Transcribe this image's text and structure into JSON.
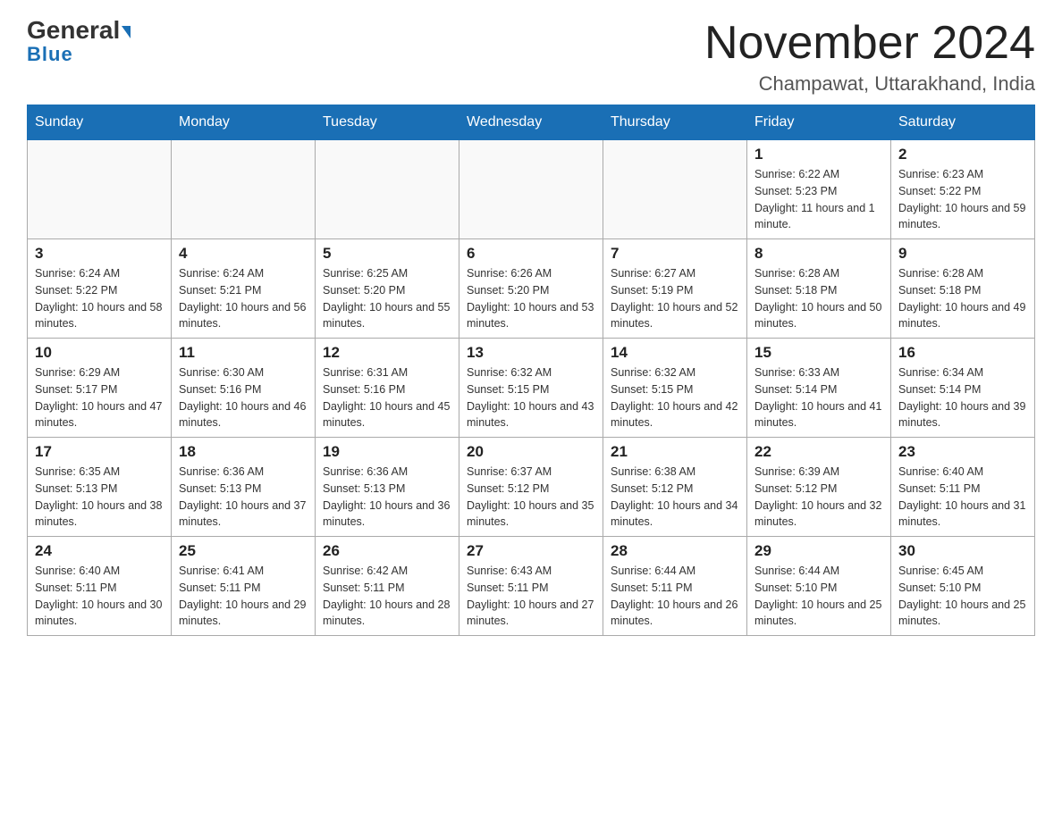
{
  "header": {
    "logo_general": "General",
    "logo_blue": "Blue",
    "month_title": "November 2024",
    "location": "Champawat, Uttarakhand, India"
  },
  "weekdays": [
    "Sunday",
    "Monday",
    "Tuesday",
    "Wednesday",
    "Thursday",
    "Friday",
    "Saturday"
  ],
  "weeks": [
    [
      {
        "day": "",
        "info": ""
      },
      {
        "day": "",
        "info": ""
      },
      {
        "day": "",
        "info": ""
      },
      {
        "day": "",
        "info": ""
      },
      {
        "day": "",
        "info": ""
      },
      {
        "day": "1",
        "info": "Sunrise: 6:22 AM\nSunset: 5:23 PM\nDaylight: 11 hours and 1 minute."
      },
      {
        "day": "2",
        "info": "Sunrise: 6:23 AM\nSunset: 5:22 PM\nDaylight: 10 hours and 59 minutes."
      }
    ],
    [
      {
        "day": "3",
        "info": "Sunrise: 6:24 AM\nSunset: 5:22 PM\nDaylight: 10 hours and 58 minutes."
      },
      {
        "day": "4",
        "info": "Sunrise: 6:24 AM\nSunset: 5:21 PM\nDaylight: 10 hours and 56 minutes."
      },
      {
        "day": "5",
        "info": "Sunrise: 6:25 AM\nSunset: 5:20 PM\nDaylight: 10 hours and 55 minutes."
      },
      {
        "day": "6",
        "info": "Sunrise: 6:26 AM\nSunset: 5:20 PM\nDaylight: 10 hours and 53 minutes."
      },
      {
        "day": "7",
        "info": "Sunrise: 6:27 AM\nSunset: 5:19 PM\nDaylight: 10 hours and 52 minutes."
      },
      {
        "day": "8",
        "info": "Sunrise: 6:28 AM\nSunset: 5:18 PM\nDaylight: 10 hours and 50 minutes."
      },
      {
        "day": "9",
        "info": "Sunrise: 6:28 AM\nSunset: 5:18 PM\nDaylight: 10 hours and 49 minutes."
      }
    ],
    [
      {
        "day": "10",
        "info": "Sunrise: 6:29 AM\nSunset: 5:17 PM\nDaylight: 10 hours and 47 minutes."
      },
      {
        "day": "11",
        "info": "Sunrise: 6:30 AM\nSunset: 5:16 PM\nDaylight: 10 hours and 46 minutes."
      },
      {
        "day": "12",
        "info": "Sunrise: 6:31 AM\nSunset: 5:16 PM\nDaylight: 10 hours and 45 minutes."
      },
      {
        "day": "13",
        "info": "Sunrise: 6:32 AM\nSunset: 5:15 PM\nDaylight: 10 hours and 43 minutes."
      },
      {
        "day": "14",
        "info": "Sunrise: 6:32 AM\nSunset: 5:15 PM\nDaylight: 10 hours and 42 minutes."
      },
      {
        "day": "15",
        "info": "Sunrise: 6:33 AM\nSunset: 5:14 PM\nDaylight: 10 hours and 41 minutes."
      },
      {
        "day": "16",
        "info": "Sunrise: 6:34 AM\nSunset: 5:14 PM\nDaylight: 10 hours and 39 minutes."
      }
    ],
    [
      {
        "day": "17",
        "info": "Sunrise: 6:35 AM\nSunset: 5:13 PM\nDaylight: 10 hours and 38 minutes."
      },
      {
        "day": "18",
        "info": "Sunrise: 6:36 AM\nSunset: 5:13 PM\nDaylight: 10 hours and 37 minutes."
      },
      {
        "day": "19",
        "info": "Sunrise: 6:36 AM\nSunset: 5:13 PM\nDaylight: 10 hours and 36 minutes."
      },
      {
        "day": "20",
        "info": "Sunrise: 6:37 AM\nSunset: 5:12 PM\nDaylight: 10 hours and 35 minutes."
      },
      {
        "day": "21",
        "info": "Sunrise: 6:38 AM\nSunset: 5:12 PM\nDaylight: 10 hours and 34 minutes."
      },
      {
        "day": "22",
        "info": "Sunrise: 6:39 AM\nSunset: 5:12 PM\nDaylight: 10 hours and 32 minutes."
      },
      {
        "day": "23",
        "info": "Sunrise: 6:40 AM\nSunset: 5:11 PM\nDaylight: 10 hours and 31 minutes."
      }
    ],
    [
      {
        "day": "24",
        "info": "Sunrise: 6:40 AM\nSunset: 5:11 PM\nDaylight: 10 hours and 30 minutes."
      },
      {
        "day": "25",
        "info": "Sunrise: 6:41 AM\nSunset: 5:11 PM\nDaylight: 10 hours and 29 minutes."
      },
      {
        "day": "26",
        "info": "Sunrise: 6:42 AM\nSunset: 5:11 PM\nDaylight: 10 hours and 28 minutes."
      },
      {
        "day": "27",
        "info": "Sunrise: 6:43 AM\nSunset: 5:11 PM\nDaylight: 10 hours and 27 minutes."
      },
      {
        "day": "28",
        "info": "Sunrise: 6:44 AM\nSunset: 5:11 PM\nDaylight: 10 hours and 26 minutes."
      },
      {
        "day": "29",
        "info": "Sunrise: 6:44 AM\nSunset: 5:10 PM\nDaylight: 10 hours and 25 minutes."
      },
      {
        "day": "30",
        "info": "Sunrise: 6:45 AM\nSunset: 5:10 PM\nDaylight: 10 hours and 25 minutes."
      }
    ]
  ]
}
